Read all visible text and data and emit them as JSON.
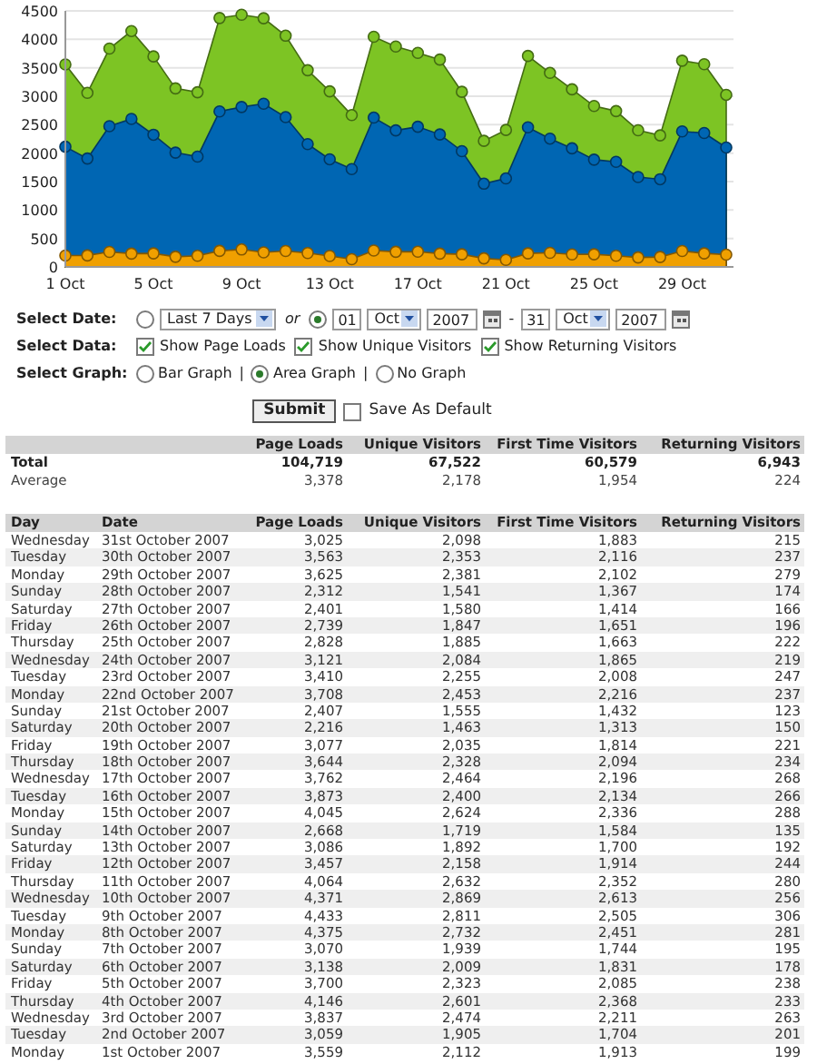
{
  "chart": {
    "chart_data": {
      "type": "area",
      "categories": [
        "1 Oct",
        null,
        null,
        null,
        "5 Oct",
        null,
        null,
        null,
        "9 Oct",
        null,
        null,
        null,
        "13 Oct",
        null,
        null,
        null,
        "17 Oct",
        null,
        null,
        null,
        "21 Oct",
        null,
        null,
        null,
        "25 Oct",
        null,
        null,
        null,
        "29 Oct",
        null,
        null
      ],
      "yticks": [
        0,
        500,
        1000,
        1500,
        2000,
        2500,
        3000,
        3500,
        4000,
        4500
      ],
      "ylim": [
        0,
        4500
      ],
      "stacked": false,
      "grid": true,
      "series": [
        {
          "color": "#7dc424",
          "values": [
            3559,
            3059,
            3837,
            4146,
            3700,
            3138,
            3070,
            4375,
            4433,
            4371,
            4064,
            3457,
            3086,
            2668,
            4045,
            3873,
            3762,
            3644,
            3077,
            2216,
            2407,
            3708,
            3410,
            3121,
            2828,
            2739,
            2401,
            2312,
            3625,
            3563,
            3025
          ]
        },
        {
          "color": "#0066b3",
          "values": [
            2112,
            1905,
            2474,
            2601,
            2323,
            2009,
            1939,
            2732,
            2811,
            2869,
            2632,
            2158,
            1892,
            1719,
            2624,
            2400,
            2464,
            2328,
            2035,
            1463,
            1555,
            2453,
            2255,
            2084,
            1885,
            1847,
            1580,
            1541,
            2381,
            2353,
            2098
          ]
        },
        {
          "color": "#f0a000",
          "values": [
            199,
            201,
            263,
            233,
            238,
            178,
            195,
            281,
            306,
            256,
            280,
            244,
            192,
            135,
            288,
            266,
            268,
            234,
            221,
            150,
            123,
            237,
            247,
            219,
            222,
            196,
            166,
            174,
            279,
            237,
            215
          ]
        }
      ]
    }
  },
  "filters": {
    "date": {
      "label": "Select Date:",
      "preset": {
        "selected": false,
        "value": "Last 7 Days"
      },
      "connector": "or",
      "range": {
        "selected": true,
        "from_day": "01",
        "from_month": "Oct",
        "from_year": "2007",
        "separator": "-",
        "to_day": "31",
        "to_month": "Oct",
        "to_year": "2007"
      }
    },
    "data": {
      "label": "Select Data:",
      "options": [
        {
          "label": "Show Page Loads",
          "checked": true
        },
        {
          "label": "Show Unique Visitors",
          "checked": true
        },
        {
          "label": "Show Returning Visitors",
          "checked": true
        }
      ]
    },
    "graph": {
      "label": "Select Graph:",
      "options": [
        {
          "label": "Bar Graph",
          "selected": false,
          "separator": "|"
        },
        {
          "label": "Area Graph",
          "selected": true,
          "separator": "|"
        },
        {
          "label": "No Graph",
          "selected": false
        }
      ]
    }
  },
  "submit": "Submit",
  "save_default": {
    "label": "Save As Default",
    "checked": false
  },
  "summary": {
    "columns": [
      "Page Loads",
      "Unique Visitors",
      "First Time Visitors",
      "Returning Visitors"
    ],
    "rows": [
      {
        "kind": "total",
        "label": "Total",
        "values": [
          "104,719",
          "67,522",
          "60,579",
          "6,943"
        ]
      },
      {
        "kind": "average",
        "label": "Average",
        "values": [
          "3,378",
          "2,178",
          "1,954",
          "224"
        ]
      }
    ]
  },
  "daily": {
    "columns": [
      "Day",
      "Date",
      "Page Loads",
      "Unique Visitors",
      "First Time Visitors",
      "Returning Visitors"
    ],
    "rows": [
      [
        "Wednesday",
        "31st October 2007",
        "3,025",
        "2,098",
        "1,883",
        "215"
      ],
      [
        "Tuesday",
        "30th October 2007",
        "3,563",
        "2,353",
        "2,116",
        "237"
      ],
      [
        "Monday",
        "29th October 2007",
        "3,625",
        "2,381",
        "2,102",
        "279"
      ],
      [
        "Sunday",
        "28th October 2007",
        "2,312",
        "1,541",
        "1,367",
        "174"
      ],
      [
        "Saturday",
        "27th October 2007",
        "2,401",
        "1,580",
        "1,414",
        "166"
      ],
      [
        "Friday",
        "26th October 2007",
        "2,739",
        "1,847",
        "1,651",
        "196"
      ],
      [
        "Thursday",
        "25th October 2007",
        "2,828",
        "1,885",
        "1,663",
        "222"
      ],
      [
        "Wednesday",
        "24th October 2007",
        "3,121",
        "2,084",
        "1,865",
        "219"
      ],
      [
        "Tuesday",
        "23rd October 2007",
        "3,410",
        "2,255",
        "2,008",
        "247"
      ],
      [
        "Monday",
        "22nd October 2007",
        "3,708",
        "2,453",
        "2,216",
        "237"
      ],
      [
        "Sunday",
        "21st October 2007",
        "2,407",
        "1,555",
        "1,432",
        "123"
      ],
      [
        "Saturday",
        "20th October 2007",
        "2,216",
        "1,463",
        "1,313",
        "150"
      ],
      [
        "Friday",
        "19th October 2007",
        "3,077",
        "2,035",
        "1,814",
        "221"
      ],
      [
        "Thursday",
        "18th October 2007",
        "3,644",
        "2,328",
        "2,094",
        "234"
      ],
      [
        "Wednesday",
        "17th October 2007",
        "3,762",
        "2,464",
        "2,196",
        "268"
      ],
      [
        "Tuesday",
        "16th October 2007",
        "3,873",
        "2,400",
        "2,134",
        "266"
      ],
      [
        "Monday",
        "15th October 2007",
        "4,045",
        "2,624",
        "2,336",
        "288"
      ],
      [
        "Sunday",
        "14th October 2007",
        "2,668",
        "1,719",
        "1,584",
        "135"
      ],
      [
        "Saturday",
        "13th October 2007",
        "3,086",
        "1,892",
        "1,700",
        "192"
      ],
      [
        "Friday",
        "12th October 2007",
        "3,457",
        "2,158",
        "1,914",
        "244"
      ],
      [
        "Thursday",
        "11th October 2007",
        "4,064",
        "2,632",
        "2,352",
        "280"
      ],
      [
        "Wednesday",
        "10th October 2007",
        "4,371",
        "2,869",
        "2,613",
        "256"
      ],
      [
        "Tuesday",
        "9th October 2007",
        "4,433",
        "2,811",
        "2,505",
        "306"
      ],
      [
        "Monday",
        "8th October 2007",
        "4,375",
        "2,732",
        "2,451",
        "281"
      ],
      [
        "Sunday",
        "7th October 2007",
        "3,070",
        "1,939",
        "1,744",
        "195"
      ],
      [
        "Saturday",
        "6th October 2007",
        "3,138",
        "2,009",
        "1,831",
        "178"
      ],
      [
        "Friday",
        "5th October 2007",
        "3,700",
        "2,323",
        "2,085",
        "238"
      ],
      [
        "Thursday",
        "4th October 2007",
        "4,146",
        "2,601",
        "2,368",
        "233"
      ],
      [
        "Wednesday",
        "3rd October 2007",
        "3,837",
        "2,474",
        "2,211",
        "263"
      ],
      [
        "Tuesday",
        "2nd October 2007",
        "3,059",
        "1,905",
        "1,704",
        "201"
      ],
      [
        "Monday",
        "1st October 2007",
        "3,559",
        "2,112",
        "1,913",
        "199"
      ]
    ]
  }
}
